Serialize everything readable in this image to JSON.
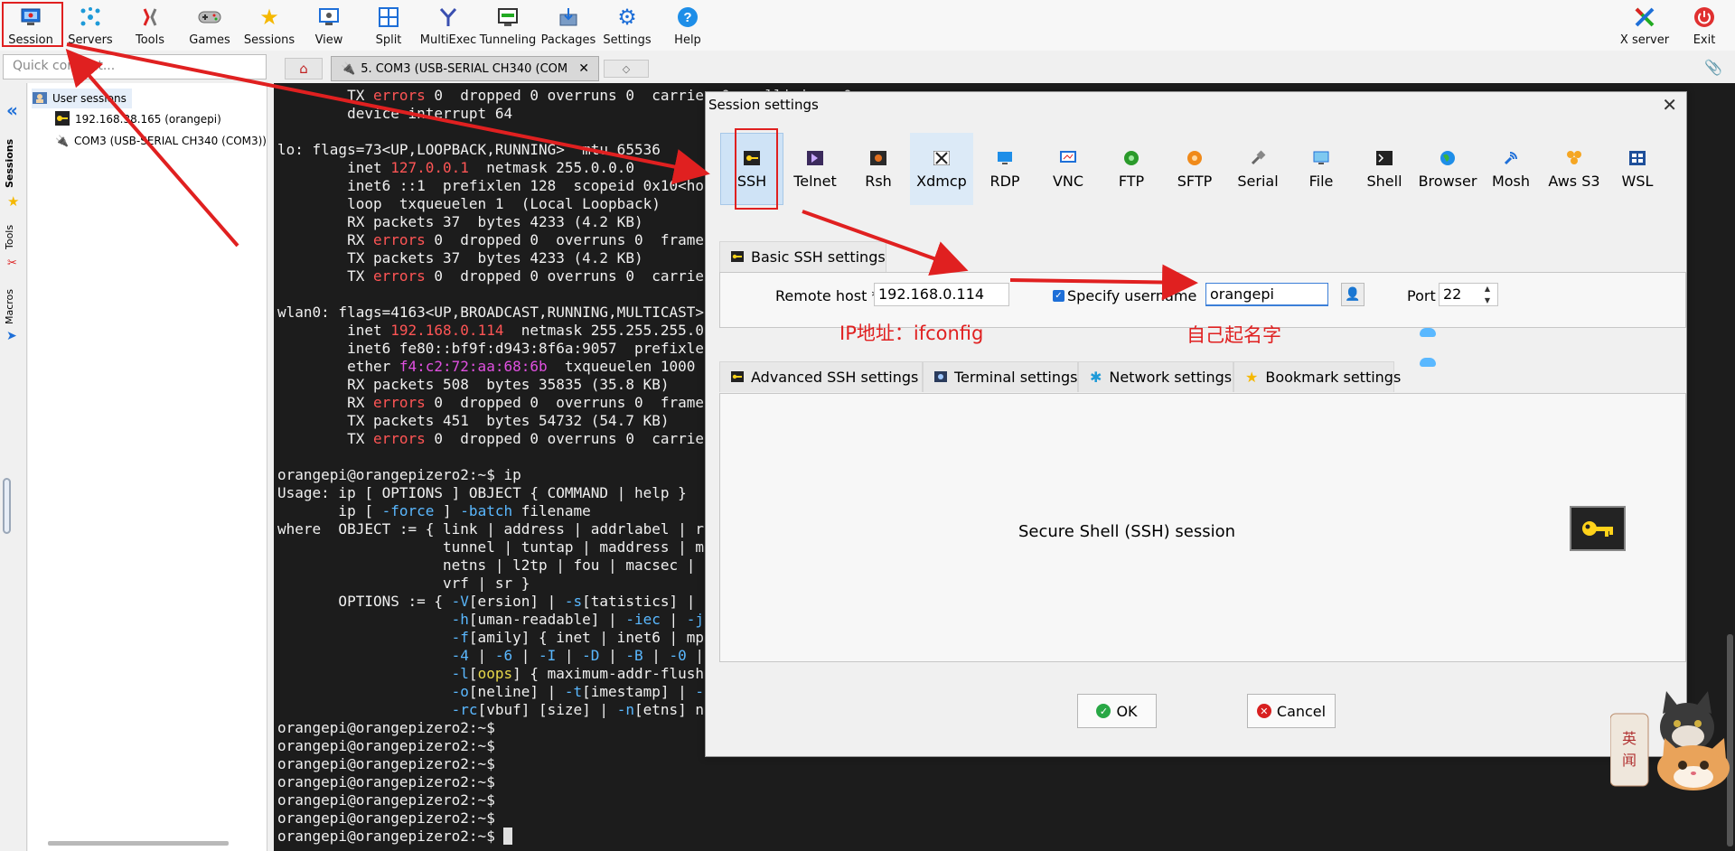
{
  "toolbar": {
    "items": [
      {
        "label": "Session",
        "icon": "monitor-icon"
      },
      {
        "label": "Servers",
        "icon": "servers-icon"
      },
      {
        "label": "Tools",
        "icon": "tools-icon"
      },
      {
        "label": "Games",
        "icon": "gamepad-icon"
      },
      {
        "label": "Sessions",
        "icon": "star-icon"
      },
      {
        "label": "View",
        "icon": "view-icon"
      },
      {
        "label": "Split",
        "icon": "split-icon"
      },
      {
        "label": "MultiExec",
        "icon": "multiexec-icon"
      },
      {
        "label": "Tunneling",
        "icon": "tunnel-icon"
      },
      {
        "label": "Packages",
        "icon": "packages-icon"
      },
      {
        "label": "Settings",
        "icon": "gear-icon"
      },
      {
        "label": "Help",
        "icon": "help-icon"
      }
    ],
    "xserver": "X server",
    "exit": "Exit"
  },
  "quick_connect": {
    "placeholder": "Quick connect..."
  },
  "tabs": {
    "session_tab": "5. COM3  (USB-SERIAL CH340 (COM"
  },
  "sidebar": {
    "vertical_tabs": [
      "Sessions",
      "Tools",
      "Macros"
    ],
    "root": "User sessions",
    "items": [
      "192.168.38.165 (orangepi)",
      "COM3  (USB-SERIAL CH340 (COM3))"
    ]
  },
  "terminal": {
    "prompt": "orangepi@orangepizero2:~$"
  },
  "dialog": {
    "title": "Session settings",
    "session_types": [
      "SSH",
      "Telnet",
      "Rsh",
      "Xdmcp",
      "RDP",
      "VNC",
      "FTP",
      "SFTP",
      "Serial",
      "File",
      "Shell",
      "Browser",
      "Mosh",
      "Aws S3",
      "WSL"
    ],
    "basic_tab": "Basic SSH settings",
    "remote_host_label": "Remote host *",
    "remote_host_value": "192.168.0.114",
    "specify_username_label": "Specify username",
    "username_value": "orangepi",
    "port_label": "Port",
    "port_value": "22",
    "annotation_ip": "IP地址：ifconfig",
    "annotation_name": "自己起名字",
    "adv_tabs": [
      "Advanced SSH settings",
      "Terminal settings",
      "Network settings",
      "Bookmark settings"
    ],
    "description": "Secure Shell (SSH) session",
    "ok": "OK",
    "cancel": "Cancel",
    "stamp": "英闻"
  },
  "colors": {
    "annotation": "#e02020",
    "accent": "#1e6fd8",
    "terminal_bg": "#1c1c1c"
  }
}
